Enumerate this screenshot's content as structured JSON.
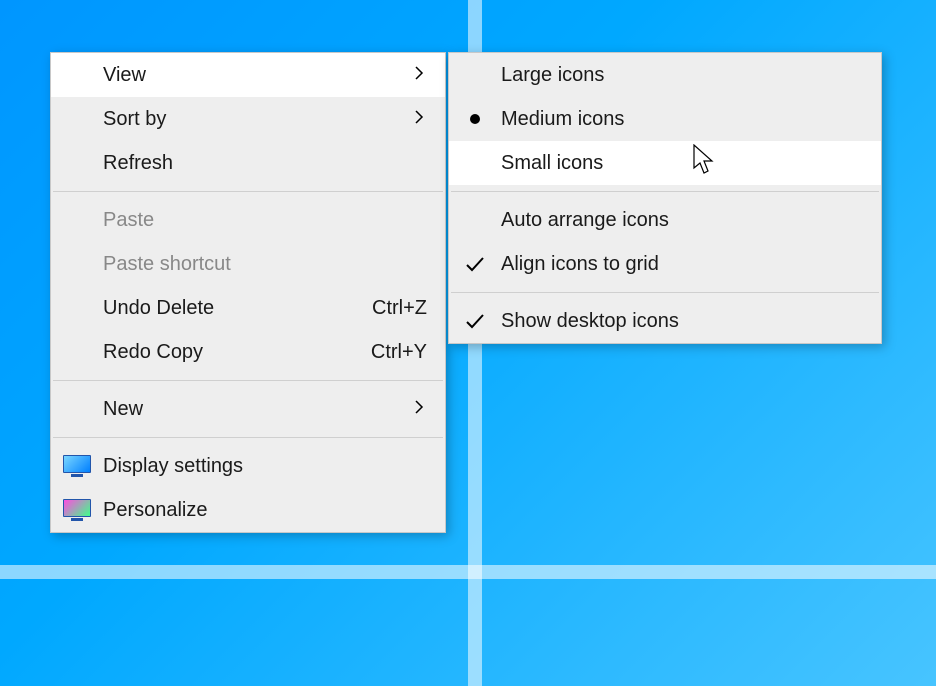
{
  "contextMenu": {
    "view": {
      "label": "View"
    },
    "sortBy": {
      "label": "Sort by"
    },
    "refresh": {
      "label": "Refresh"
    },
    "paste": {
      "label": "Paste"
    },
    "pasteShortcut": {
      "label": "Paste shortcut"
    },
    "undoDelete": {
      "label": "Undo Delete",
      "shortcut": "Ctrl+Z"
    },
    "redoCopy": {
      "label": "Redo Copy",
      "shortcut": "Ctrl+Y"
    },
    "new": {
      "label": "New"
    },
    "displaySettings": {
      "label": "Display settings"
    },
    "personalize": {
      "label": "Personalize"
    }
  },
  "viewSubmenu": {
    "largeIcons": {
      "label": "Large icons"
    },
    "mediumIcons": {
      "label": "Medium icons",
      "selected": true
    },
    "smallIcons": {
      "label": "Small icons"
    },
    "autoArrange": {
      "label": "Auto arrange icons"
    },
    "alignGrid": {
      "label": "Align icons to grid",
      "checked": true
    },
    "showDesktop": {
      "label": "Show desktop icons",
      "checked": true
    }
  }
}
